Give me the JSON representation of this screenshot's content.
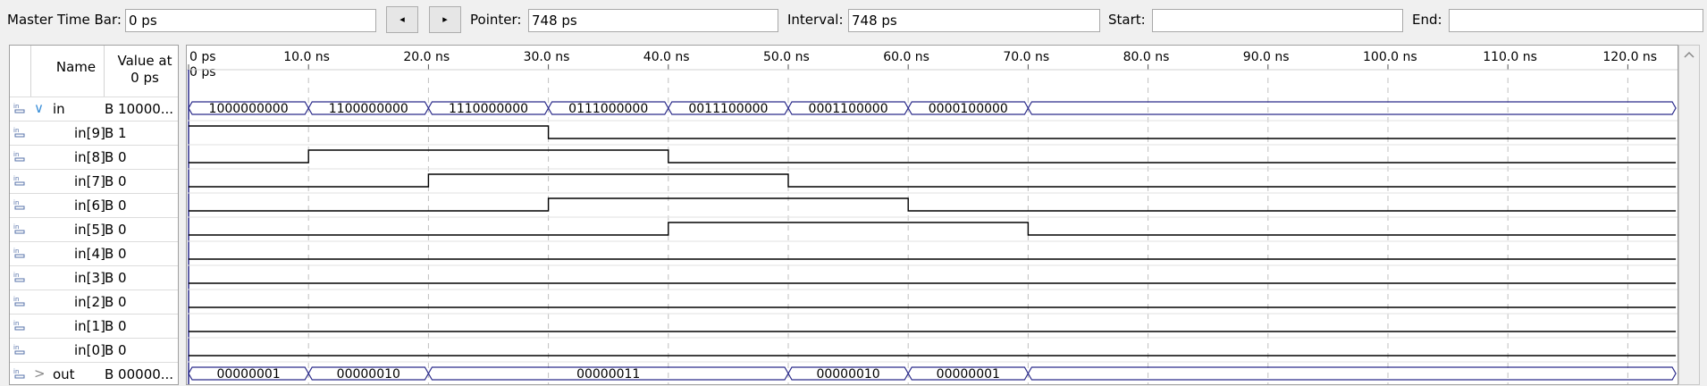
{
  "toolbar": {
    "master_time_bar_label": "Master Time Bar:",
    "master_time_bar_value": "0 ps",
    "prev_icon": "◂",
    "next_icon": "▸",
    "pointer_label": "Pointer:",
    "pointer_value": "748 ps",
    "interval_label": "Interval:",
    "interval_value": "748 ps",
    "start_label": "Start:",
    "start_value": "",
    "end_label": "End:",
    "end_value": ""
  },
  "columns": {
    "name": "Name",
    "value_at": "Value at",
    "value_at_time": "0 ps"
  },
  "time_scale": [
    "0 ps",
    "10.0 ns",
    "20.0 ns",
    "30.0 ns",
    "40.0 ns",
    "50.0 ns",
    "60.0 ns",
    "70.0 ns",
    "80.0 ns",
    "90.0 ns",
    "100.0 ns",
    "110.0 ns",
    "120.0 ns"
  ],
  "cursor_label": "0 ps",
  "signals": [
    {
      "name": "in",
      "value": "B 10000...",
      "type": "bus",
      "icon": "input-bus-icon",
      "expand": "∨",
      "segments": [
        [
          "1000000000",
          0,
          10
        ],
        [
          "1100000000",
          10,
          20
        ],
        [
          "1110000000",
          20,
          30
        ],
        [
          "0111000000",
          30,
          40
        ],
        [
          "0011100000",
          40,
          50
        ],
        [
          "0001100000",
          50,
          60
        ],
        [
          "0000100000",
          60,
          70
        ],
        [
          "",
          70,
          124
        ]
      ]
    },
    {
      "name": "in[9]",
      "value": "B 1",
      "type": "bit",
      "icon": "input-pin-icon",
      "transitions": [
        [
          0,
          1
        ],
        [
          30,
          0
        ]
      ]
    },
    {
      "name": "in[8]",
      "value": "B 0",
      "type": "bit",
      "icon": "input-pin-icon",
      "transitions": [
        [
          0,
          0
        ],
        [
          10,
          1
        ],
        [
          40,
          0
        ]
      ]
    },
    {
      "name": "in[7]",
      "value": "B 0",
      "type": "bit",
      "icon": "input-pin-icon",
      "transitions": [
        [
          0,
          0
        ],
        [
          20,
          1
        ],
        [
          50,
          0
        ]
      ]
    },
    {
      "name": "in[6]",
      "value": "B 0",
      "type": "bit",
      "icon": "input-pin-icon",
      "transitions": [
        [
          0,
          0
        ],
        [
          30,
          1
        ],
        [
          60,
          0
        ]
      ]
    },
    {
      "name": "in[5]",
      "value": "B 0",
      "type": "bit",
      "icon": "input-pin-icon",
      "transitions": [
        [
          0,
          0
        ],
        [
          40,
          1
        ],
        [
          70,
          0
        ]
      ]
    },
    {
      "name": "in[4]",
      "value": "B 0",
      "type": "bit",
      "icon": "input-pin-icon",
      "transitions": [
        [
          0,
          0
        ]
      ]
    },
    {
      "name": "in[3]",
      "value": "B 0",
      "type": "bit",
      "icon": "input-pin-icon",
      "transitions": [
        [
          0,
          0
        ]
      ]
    },
    {
      "name": "in[2]",
      "value": "B 0",
      "type": "bit",
      "icon": "input-pin-icon",
      "transitions": [
        [
          0,
          0
        ]
      ]
    },
    {
      "name": "in[1]",
      "value": "B 0",
      "type": "bit",
      "icon": "input-pin-icon",
      "transitions": [
        [
          0,
          0
        ]
      ]
    },
    {
      "name": "in[0]",
      "value": "B 0",
      "type": "bit",
      "icon": "input-pin-icon",
      "transitions": [
        [
          0,
          0
        ]
      ]
    },
    {
      "name": "out",
      "value": "B 00000...",
      "type": "bus",
      "icon": "output-bus-icon",
      "expand": ">",
      "segments": [
        [
          "00000001",
          0,
          10
        ],
        [
          "00000010",
          10,
          20
        ],
        [
          "00000011",
          20,
          50
        ],
        [
          "00000010",
          50,
          60
        ],
        [
          "00000001",
          60,
          70
        ],
        [
          "",
          70,
          124
        ]
      ]
    }
  ],
  "colors": {
    "wave": "#000000",
    "bus_outline": "#2a2a8a",
    "grid": "#c0c0c0",
    "cursor": "#2a2a8a",
    "icon": "#5470a8"
  }
}
